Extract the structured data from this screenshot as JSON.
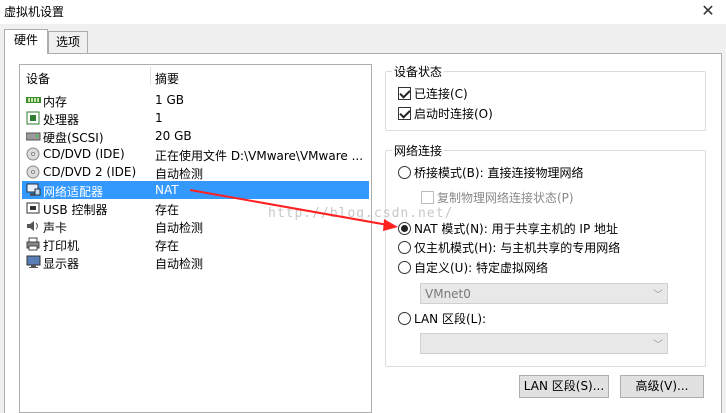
{
  "window": {
    "title": "虚拟机设置",
    "close": "✕"
  },
  "tabs": [
    {
      "label": "硬件"
    },
    {
      "label": "选项"
    }
  ],
  "device_list": {
    "headers": {
      "device": "设备",
      "summary": "摘要"
    },
    "rows": [
      {
        "name": "内存",
        "summary": "1 GB",
        "icon": "memory-icon"
      },
      {
        "name": "处理器",
        "summary": "1",
        "icon": "processor-icon"
      },
      {
        "name": "硬盘(SCSI)",
        "summary": "20 GB",
        "icon": "harddisk-icon"
      },
      {
        "name": "CD/DVD (IDE)",
        "summary": "正在使用文件 D:\\VMware\\VMware ...",
        "icon": "cd-dvd-icon"
      },
      {
        "name": "CD/DVD 2 (IDE)",
        "summary": "自动检测",
        "icon": "cd-dvd-icon"
      },
      {
        "name": "网络适配器",
        "summary": "NAT",
        "icon": "network-adapter-icon"
      },
      {
        "name": "USB 控制器",
        "summary": "存在",
        "icon": "usb-icon"
      },
      {
        "name": "声卡",
        "summary": "自动检测",
        "icon": "sound-card-icon"
      },
      {
        "name": "打印机",
        "summary": "存在",
        "icon": "printer-icon"
      },
      {
        "name": "显示器",
        "summary": "自动检测",
        "icon": "display-icon"
      }
    ],
    "selected_index": 5
  },
  "device_status": {
    "legend": "设备状态",
    "connected": {
      "label": "已连接(C)",
      "checked": true
    },
    "connect_on_power": {
      "label": "启动时连接(O)",
      "checked": true
    }
  },
  "network_connection": {
    "legend": "网络连接",
    "bridged": {
      "label": "桥接模式(B): 直接连接物理网络",
      "checked": false
    },
    "replicate": {
      "label": "复制物理网络连接状态(P)",
      "checked": false,
      "disabled": true
    },
    "nat": {
      "label": "NAT 模式(N): 用于共享主机的 IP 地址",
      "checked": true
    },
    "host_only": {
      "label": "仅主机模式(H): 与主机共享的专用网络",
      "checked": false
    },
    "custom": {
      "label": "自定义(U): 特定虚拟网络",
      "checked": false
    },
    "custom_select": {
      "value": "VMnet0"
    },
    "lan_segment": {
      "label": "LAN 区段(L):",
      "checked": false
    },
    "lan_select": {
      "value": ""
    }
  },
  "buttons": {
    "lan_segment": "LAN 区段(S)...",
    "advanced": "高级(V)..."
  },
  "watermark": "http://blog.csdn.net/",
  "colors": {
    "selection": "#3399ff",
    "arrow": "#ff2020"
  }
}
